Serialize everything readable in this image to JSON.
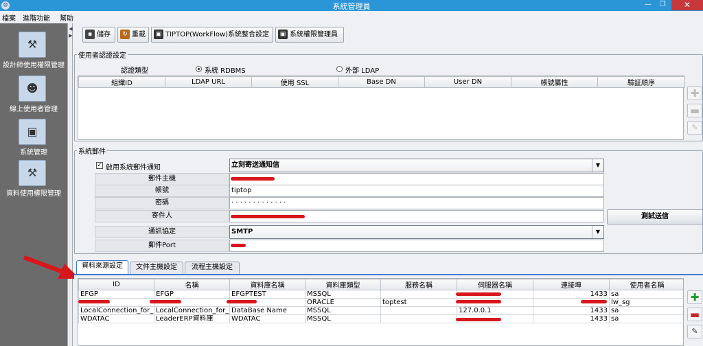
{
  "window": {
    "title": "系統管理員",
    "minimize": "—",
    "restore": "❐",
    "close": "✕"
  },
  "menu": [
    "檔案",
    "進階功能",
    "幫助"
  ],
  "sidebar": {
    "items": [
      {
        "label": "設計師使用權限管理",
        "icon": "hammer-icon"
      },
      {
        "label": "線上使用者管理",
        "icon": "users-icon"
      },
      {
        "label": "系統管理",
        "icon": "monitor-icon"
      },
      {
        "label": "資料使用權限管理",
        "icon": "hammer-icon"
      }
    ]
  },
  "toolbar": {
    "save": "儲存",
    "reload": "重載",
    "tiptop": "TIPTOP(WorkFlow)系統整合設定",
    "perm_admin": "系統權限管理員"
  },
  "auth": {
    "legend": "使用者認證設定",
    "type_label": "認證類型",
    "option_rdbms": "系統 RDBMS",
    "option_ldap": "外部 LDAP",
    "selected": "rdbms",
    "columns": [
      "組織ID",
      "LDAP URL",
      "使用 SSL",
      "Base DN",
      "User DN",
      "帳號屬性",
      "驗証順序"
    ],
    "rows": []
  },
  "mail": {
    "legend": "系統郵件",
    "enable_label": "啟用系統郵件通知",
    "enabled": true,
    "notify_mode": "立刻寄送通知信",
    "fields": {
      "host_label": "郵件主機",
      "account_label": "帳號",
      "account_value": "tiptop",
      "password_label": "密碼",
      "password_value": "· · · · · · · · · · · · ·",
      "sender_label": "寄件人",
      "protocol_label": "通訊協定",
      "protocol_value": "SMTP",
      "port_label": "郵件Port"
    },
    "test_button": "測試送信"
  },
  "tabs": [
    "資料來源設定",
    "文件主機設定",
    "流程主機設定"
  ],
  "active_tab": 0,
  "datasource": {
    "columns": [
      "ID",
      "名稱",
      "資料庫名稱",
      "資料庫類型",
      "服務名稱",
      "伺服器名稱",
      "連接埠",
      "使用者名稱"
    ],
    "rows": [
      [
        "EFGP",
        "EFGP",
        "EFGPTEST",
        "MSSQL",
        "",
        "",
        "1433",
        "sa"
      ],
      [
        "",
        "",
        "",
        "ORACLE",
        "toptest",
        "",
        "",
        "lw_sg"
      ],
      [
        "LocalConnection_for_...",
        "LocalConnection_for_...",
        "DataBase Name",
        "MSSQL",
        "",
        "127.0.0.1",
        "1433",
        "sa"
      ],
      [
        "WDATAC",
        "LeaderERP資料庫",
        "WDATAC",
        "MSSQL",
        "",
        "",
        "1433",
        "sa"
      ]
    ]
  },
  "colors": {
    "titlebar": "#2a96d8",
    "sidebar": "#6b6b6b",
    "close": "#c7383a",
    "redact": "#d8161b"
  }
}
